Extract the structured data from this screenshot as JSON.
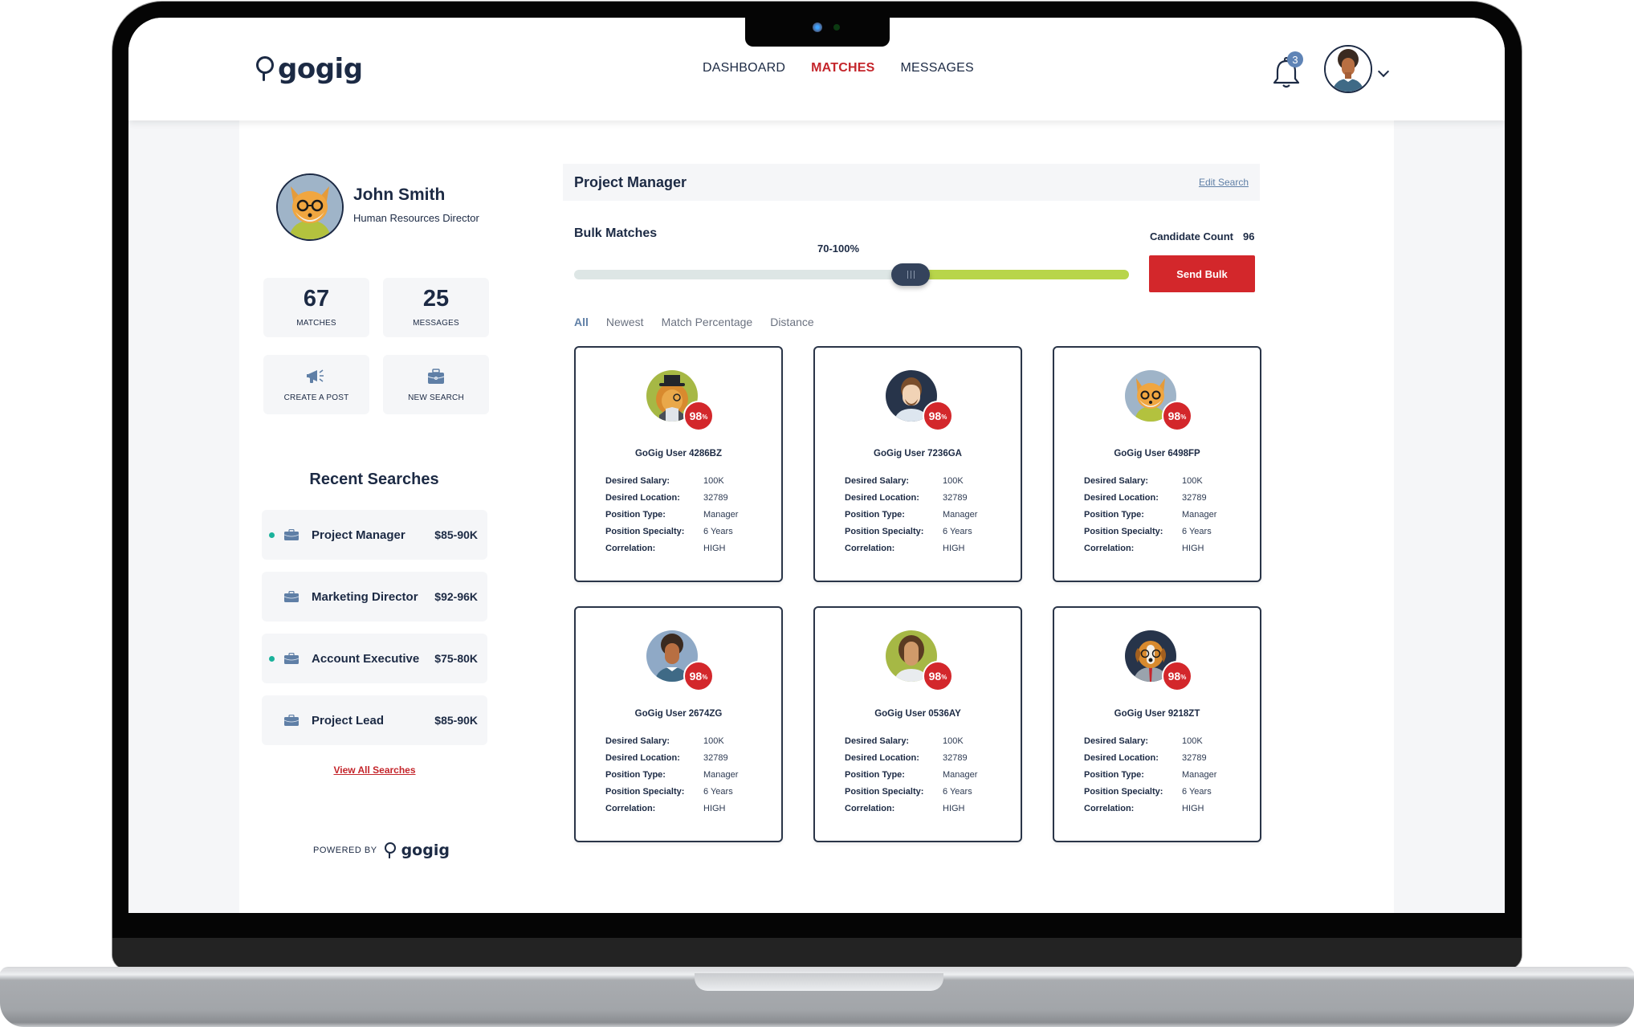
{
  "brand": {
    "name": "gogig"
  },
  "nav": {
    "items": [
      {
        "label": "DASHBOARD",
        "active": false
      },
      {
        "label": "MATCHES",
        "active": true
      },
      {
        "label": "MESSAGES",
        "active": false
      }
    ]
  },
  "notifications": {
    "count": "3"
  },
  "colors": {
    "accent_red": "#d3272b",
    "navy": "#1c2a44",
    "link_blue": "#5f7fa6",
    "slider_green": "#b8d54a",
    "status_teal": "#1ab29b"
  },
  "profile": {
    "name": "John Smith",
    "title": "Human Resources Director",
    "stats": [
      {
        "value": "67",
        "label": "MATCHES"
      },
      {
        "value": "25",
        "label": "MESSAGES"
      }
    ],
    "actions": [
      {
        "label": "CREATE A POST",
        "icon": "megaphone-icon"
      },
      {
        "label": "NEW SEARCH",
        "icon": "briefcase-icon"
      }
    ]
  },
  "recent_searches": {
    "title": "Recent Searches",
    "items": [
      {
        "title": "Project Manager",
        "salary": "$85-90K",
        "active": true
      },
      {
        "title": "Marketing Director",
        "salary": "$92-96K",
        "active": false
      },
      {
        "title": "Account Executive",
        "salary": "$75-80K",
        "active": true
      },
      {
        "title": "Project Lead",
        "salary": "$85-90K",
        "active": false
      }
    ],
    "view_all": "View All Searches"
  },
  "powered_by": {
    "label": "POWERED BY",
    "brand": "gogig"
  },
  "search": {
    "title": "Project Manager",
    "edit_label": "Edit Search",
    "bulk_label": "Bulk Matches",
    "range_label": "70-100%",
    "range_min_percent": 70,
    "range_max_percent": 100,
    "candidate_count_label": "Candidate Count",
    "candidate_count": "96",
    "send_bulk_label": "Send Bulk"
  },
  "tabs": [
    {
      "label": "All",
      "active": true
    },
    {
      "label": "Newest",
      "active": false
    },
    {
      "label": "Match Percentage",
      "active": false
    },
    {
      "label": "Distance",
      "active": false
    }
  ],
  "field_labels": {
    "salary": "Desired Salary:",
    "location": "Desired Location:",
    "type": "Position Type:",
    "specialty": "Position Specialty:",
    "correlation": "Correlation:"
  },
  "candidates": [
    {
      "name": "GoGig User 4286BZ",
      "match": "98",
      "avatar": "lion-avatar",
      "salary": "100K",
      "location": "32789",
      "type": "Manager",
      "specialty": "6 Years",
      "correlation": "HIGH"
    },
    {
      "name": "GoGig User 7236GA",
      "match": "98",
      "avatar": "bearded-man-avatar",
      "salary": "100K",
      "location": "32789",
      "type": "Manager",
      "specialty": "6 Years",
      "correlation": "HIGH"
    },
    {
      "name": "GoGig User 6498FP",
      "match": "98",
      "avatar": "fox-avatar",
      "salary": "100K",
      "location": "32789",
      "type": "Manager",
      "specialty": "6 Years",
      "correlation": "HIGH"
    },
    {
      "name": "GoGig User 2674ZG",
      "match": "98",
      "avatar": "curly-woman-avatar",
      "salary": "100K",
      "location": "32789",
      "type": "Manager",
      "specialty": "6 Years",
      "correlation": "HIGH"
    },
    {
      "name": "GoGig User 0536AY",
      "match": "98",
      "avatar": "woman-avatar",
      "salary": "100K",
      "location": "32789",
      "type": "Manager",
      "specialty": "6 Years",
      "correlation": "HIGH"
    },
    {
      "name": "GoGig User 9218ZT",
      "match": "98",
      "avatar": "dog-avatar",
      "salary": "100K",
      "location": "32789",
      "type": "Manager",
      "specialty": "6 Years",
      "correlation": "HIGH"
    }
  ],
  "percent_sign": "%"
}
